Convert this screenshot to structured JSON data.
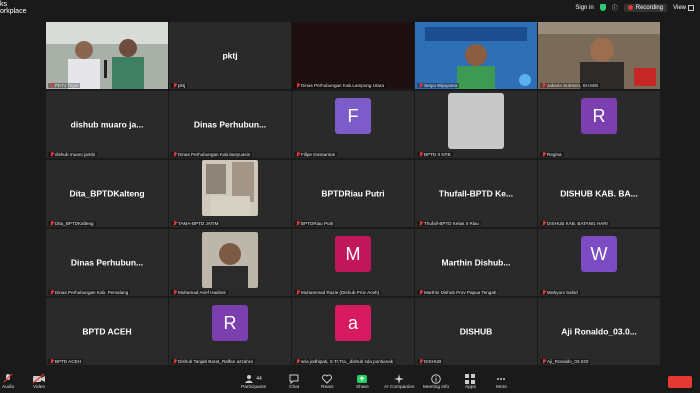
{
  "app": {
    "title": "ks\norkplace"
  },
  "topbar": {
    "signin": "Sign in",
    "recording": "Recording",
    "view": "View"
  },
  "tiles": [
    {
      "type": "photo",
      "label": "PKTJ Tegal",
      "active": true
    },
    {
      "type": "name",
      "name": "pktj",
      "label": "pktj"
    },
    {
      "type": "dark",
      "label": "Dinas Perhubungan Kab.Lampung Utara"
    },
    {
      "type": "photo",
      "label": "Setya Wijayanta"
    },
    {
      "type": "photo",
      "label": "Jakaria Sutrisno, SH.MSi"
    },
    {
      "type": "name",
      "name": "dishub  muaro  ja...",
      "label": "dishub muaro jambi"
    },
    {
      "type": "name",
      "name": "Dinas  Perhubun...",
      "label": "Dinas Perhubungan Kab.banyuasin"
    },
    {
      "type": "avatar",
      "letter": "F",
      "color": "#7b5cc9",
      "label": "Filipe Dossantos"
    },
    {
      "type": "blank",
      "label": "BPTD II NTB"
    },
    {
      "type": "avatar",
      "letter": "R",
      "color": "#7b3fb0",
      "label": "Regina"
    },
    {
      "type": "name",
      "name": "Dita_BPTDKalteng",
      "label": "Dita_BPTDKalteng"
    },
    {
      "type": "photo",
      "label": "TAMA-BPTD JATIM"
    },
    {
      "type": "name",
      "name": "BPTDRiau  Putri",
      "label": "BPTDRiau Putri"
    },
    {
      "type": "name",
      "name": "Thufall-BPTD  Ke...",
      "label": "Thufall-BPTD Kelas II Riau"
    },
    {
      "type": "name",
      "name": "DISHUB  KAB.  BA...",
      "label": "DISHUB KAB. BATANG HARI"
    },
    {
      "type": "name",
      "name": "Dinas  Perhubun...",
      "label": "Dinas Perhubungan Kab. Pemalang"
    },
    {
      "type": "photo",
      "label": "Muhamad Arief Hadimir"
    },
    {
      "type": "avatar",
      "letter": "M",
      "color": "#c0185b",
      "label": "Muhammad Razie (Dishub Prov Aceh)"
    },
    {
      "type": "name",
      "name": "Marthin  Dishub...",
      "label": "Marthin Dishub Prov Papua Tengah"
    },
    {
      "type": "avatar",
      "letter": "W",
      "color": "#7b4cc4",
      "label": "Wahyuni Sahid"
    },
    {
      "type": "name",
      "name": "BPTD  ACEH",
      "label": "BPTD ACEH"
    },
    {
      "type": "avatar",
      "letter": "R",
      "color": "#7b3fb0",
      "label": "Dishub Tanjab Barat_Raffan azzahra"
    },
    {
      "type": "avatar",
      "letter": "a",
      "color": "#d81b60",
      "label": "aria jodhipati, S.Tr.Tra._dishub sda pontianak"
    },
    {
      "type": "name",
      "name": "DISHUB",
      "label": "DISHUB"
    },
    {
      "type": "name",
      "name": "Aji  Ronaldo_03.0...",
      "label": "Aji_Ronaldo_03.040"
    }
  ],
  "toolbar": {
    "audio": "Audio",
    "video": "Video",
    "participants": "Participants",
    "participants_count": "44",
    "chat": "Chat",
    "react": "React",
    "share": "Share",
    "ai": "AI Companion",
    "info": "Meeting info",
    "apps": "Apps",
    "more": "More"
  }
}
